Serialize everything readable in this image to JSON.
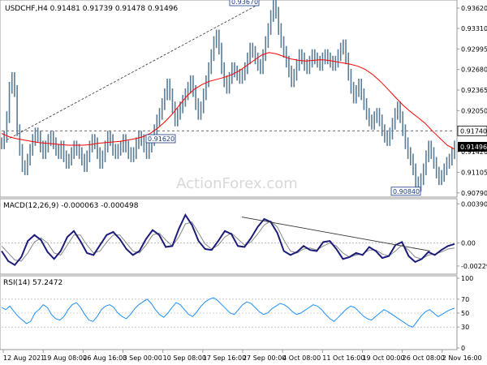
{
  "chart_data": [
    {
      "type": "line",
      "panel": "price",
      "title": "USDCHF,H4 0.91481 0.91739 0.91478 0.91496",
      "series": [
        {
          "values": [
            0.9155,
            0.9165,
            0.9195,
            0.924,
            0.9255,
            0.9235,
            0.9175,
            0.9145,
            0.912,
            0.9115,
            0.913,
            0.9145,
            0.916,
            0.917,
            0.9165,
            0.915,
            0.914,
            0.915,
            0.916,
            0.9165,
            0.9155,
            0.9145,
            0.914,
            0.915,
            0.9135,
            0.9125,
            0.913,
            0.914,
            0.915,
            0.9145,
            0.914,
            0.913,
            0.912,
            0.9135,
            0.915,
            0.916,
            0.9155,
            0.914,
            0.9125,
            0.9135,
            0.915,
            0.9165,
            0.916,
            0.9145,
            0.914,
            0.9145,
            0.915,
            0.916,
            0.915,
            0.914,
            0.9135,
            0.914,
            0.9155,
            0.9165,
            0.916,
            0.915,
            0.914,
            0.915,
            0.916,
            0.9175,
            0.919,
            0.92,
            0.9215,
            0.923,
            0.9245,
            0.923,
            0.921,
            0.919,
            0.92,
            0.921,
            0.922,
            0.923,
            0.924,
            0.925,
            0.9235,
            0.9215,
            0.92,
            0.921,
            0.923,
            0.925,
            0.927,
            0.929,
            0.931,
            0.932,
            0.93,
            0.927,
            0.925,
            0.924,
            0.9255,
            0.927,
            0.9265,
            0.926,
            0.9255,
            0.926,
            0.927,
            0.9285,
            0.93,
            0.9295,
            0.9285,
            0.9275,
            0.927,
            0.929,
            0.931,
            0.933,
            0.935,
            0.9367,
            0.9355,
            0.933,
            0.931,
            0.9295,
            0.928,
            0.9265,
            0.925,
            0.926,
            0.9275,
            0.929,
            0.9285,
            0.9275,
            0.927,
            0.928,
            0.929,
            0.9285,
            0.928,
            0.9275,
            0.9285,
            0.929,
            0.9285,
            0.928,
            0.9275,
            0.928,
            0.929,
            0.93,
            0.9305,
            0.9285,
            0.926,
            0.924,
            0.9225,
            0.9235,
            0.9245,
            0.923,
            0.9215,
            0.92,
            0.919,
            0.9185,
            0.9195,
            0.92,
            0.919,
            0.9175,
            0.9165,
            0.916,
            0.917,
            0.9185,
            0.92,
            0.921,
            0.9195,
            0.9175,
            0.9155,
            0.914,
            0.913,
            0.9115,
            0.9095,
            0.909,
            0.91,
            0.9115,
            0.9135,
            0.915,
            0.914,
            0.9125,
            0.911,
            0.91,
            0.9105,
            0.9115,
            0.9125,
            0.913,
            0.914,
            0.915
          ]
        },
        {
          "values": [
            0.917,
            0.9165,
            0.9162,
            0.916,
            0.9158,
            0.9156,
            0.9155,
            0.9154,
            0.9153,
            0.9152,
            0.9152,
            0.9152,
            0.9153,
            0.9155,
            0.9156,
            0.9157,
            0.9158,
            0.916,
            0.9162,
            0.9165,
            0.917,
            0.9178,
            0.9188,
            0.92,
            0.9214,
            0.9228,
            0.9238,
            0.9245,
            0.925,
            0.9253,
            0.9256,
            0.926,
            0.9266,
            0.9274,
            0.9282,
            0.929,
            0.9294,
            0.9292,
            0.9288,
            0.9284,
            0.9282,
            0.9281,
            0.9282,
            0.9283,
            0.9282,
            0.928,
            0.9278,
            0.9276,
            0.9273,
            0.9268,
            0.926,
            0.925,
            0.9238,
            0.9226,
            0.9214,
            0.9204,
            0.9195,
            0.9186,
            0.9174,
            0.9163,
            0.9152,
            0.9146
          ]
        }
      ],
      "levels": [
        0.9367,
        0.9162,
        0.9174,
        0.9084
      ],
      "labels": [
        "0.93670",
        "0.91620",
        "0.91740",
        "0.90840"
      ],
      "current_price": "0.91496",
      "ylim": [
        0.9075,
        0.9372
      ],
      "yticks": [
        "0.93620",
        "0.93310",
        "0.92995",
        "0.92680",
        "0.92365",
        "0.92050",
        "0.91740",
        "0.91420",
        "0.91105",
        "0.90790"
      ],
      "watermark": "ActionForex.com",
      "colors": {
        "price": "#5b7c95",
        "ma": "#ff0000",
        "trendline": "#333333"
      }
    },
    {
      "type": "line",
      "panel": "macd",
      "title": "MACD(12,26,9) -0.000063 -0.000498",
      "series": [
        {
          "values": [
            -0.0008,
            -0.0018,
            -0.0022,
            -0.0014,
            0.0002,
            0.0008,
            0.0003,
            -0.0009,
            -0.0016,
            -0.0008,
            0.0006,
            0.0012,
            0.0002,
            -0.001,
            -0.0012,
            -0.0002,
            0.0008,
            0.0011,
            0.0004,
            -0.0006,
            -0.0012,
            -0.0008,
            0.0004,
            0.0013,
            0.0008,
            -0.0004,
            -0.0003,
            0.0014,
            0.0028,
            0.0018,
            0.0002,
            -0.0006,
            -0.0007,
            0.0002,
            0.0012,
            0.0009,
            -0.0003,
            -0.0004,
            0.0005,
            0.0016,
            0.0024,
            0.0021,
            0.001,
            -0.0008,
            -0.0012,
            -0.0009,
            -0.0003,
            -0.0007,
            -0.0008,
            0.0001,
            0.0002,
            -0.0006,
            -0.0016,
            -0.0014,
            -0.001,
            -0.0012,
            -0.0004,
            -0.0008,
            -0.0015,
            -0.0013,
            -0.0002,
            0.0001,
            -0.0013,
            -0.0019,
            -0.0016,
            -0.0009,
            -0.0012,
            -0.0007,
            -0.0003,
            -0.0001
          ]
        },
        {
          "values": [
            -0.0003,
            -0.001,
            -0.0017,
            -0.0018,
            -0.001,
            0.0001,
            0.0005,
            0.0,
            -0.001,
            -0.0012,
            -0.0002,
            0.0008,
            0.0008,
            -0.0002,
            -0.001,
            -0.0008,
            0.0001,
            0.0008,
            0.0008,
            0.0,
            -0.0008,
            -0.001,
            -0.0002,
            0.0008,
            0.001,
            0.0003,
            -0.0003,
            0.0006,
            0.0019,
            0.0021,
            0.001,
            -0.0001,
            -0.0006,
            -0.0002,
            0.0006,
            0.001,
            0.0004,
            -0.0002,
            0.0001,
            0.0009,
            0.0018,
            0.0022,
            0.0016,
            0.0003,
            -0.0008,
            -0.001,
            -0.0006,
            -0.0005,
            -0.0007,
            -0.0003,
            0.0,
            -0.0003,
            -0.001,
            -0.0014,
            -0.0012,
            -0.0011,
            -0.0007,
            -0.0007,
            -0.0011,
            -0.0013,
            -0.0008,
            -0.0002,
            -0.0007,
            -0.0014,
            -0.0016,
            -0.0012,
            -0.0011,
            -0.0009,
            -0.0006,
            -0.0005
          ]
        }
      ],
      "ylim": [
        -0.00295,
        0.0041
      ],
      "yticks": [
        "0.003909",
        "0.00",
        "-0.002295"
      ],
      "colors": {
        "macd": "#1c1c7a",
        "signal": "#888888",
        "trendline": "#333333"
      }
    },
    {
      "type": "line",
      "panel": "rsi",
      "title": "RSI(14) 57.2472",
      "series": [
        {
          "values": [
            58,
            55,
            60,
            52,
            45,
            40,
            35,
            38,
            50,
            55,
            62,
            58,
            48,
            42,
            40,
            45,
            55,
            62,
            65,
            58,
            48,
            40,
            38,
            45,
            55,
            60,
            62,
            58,
            50,
            45,
            42,
            48,
            56,
            62,
            66,
            70,
            64,
            55,
            48,
            44,
            50,
            58,
            65,
            62,
            55,
            48,
            45,
            52,
            60,
            66,
            70,
            72,
            68,
            62,
            56,
            50,
            48,
            55,
            62,
            66,
            64,
            58,
            52,
            48,
            50,
            56,
            60,
            64,
            62,
            58,
            52,
            48,
            50,
            54,
            58,
            62,
            60,
            55,
            48,
            42,
            38,
            44,
            50,
            56,
            60,
            58,
            52,
            46,
            42,
            40,
            45,
            50,
            55,
            52,
            48,
            44,
            40,
            36,
            32,
            30,
            38,
            46,
            52,
            55,
            50,
            45,
            48,
            52,
            55,
            57
          ]
        }
      ],
      "ylim": [
        0,
        100
      ],
      "yticks": [
        "100",
        "70",
        "50",
        "30",
        "0"
      ],
      "colors": {
        "rsi": "#1e90ff"
      }
    }
  ],
  "x_axis": {
    "ticks": [
      "12 Aug 2021",
      "19 Aug 08:00",
      "26 Aug 16:00",
      "3 Sep 00:00",
      "10 Sep 08:00",
      "17 Sep 16:00",
      "27 Sep 00:00",
      "4 Oct 08:00",
      "11 Oct 16:00",
      "19 Oct 00:00",
      "26 Oct 08:00",
      "2 Nov 16:00"
    ]
  }
}
